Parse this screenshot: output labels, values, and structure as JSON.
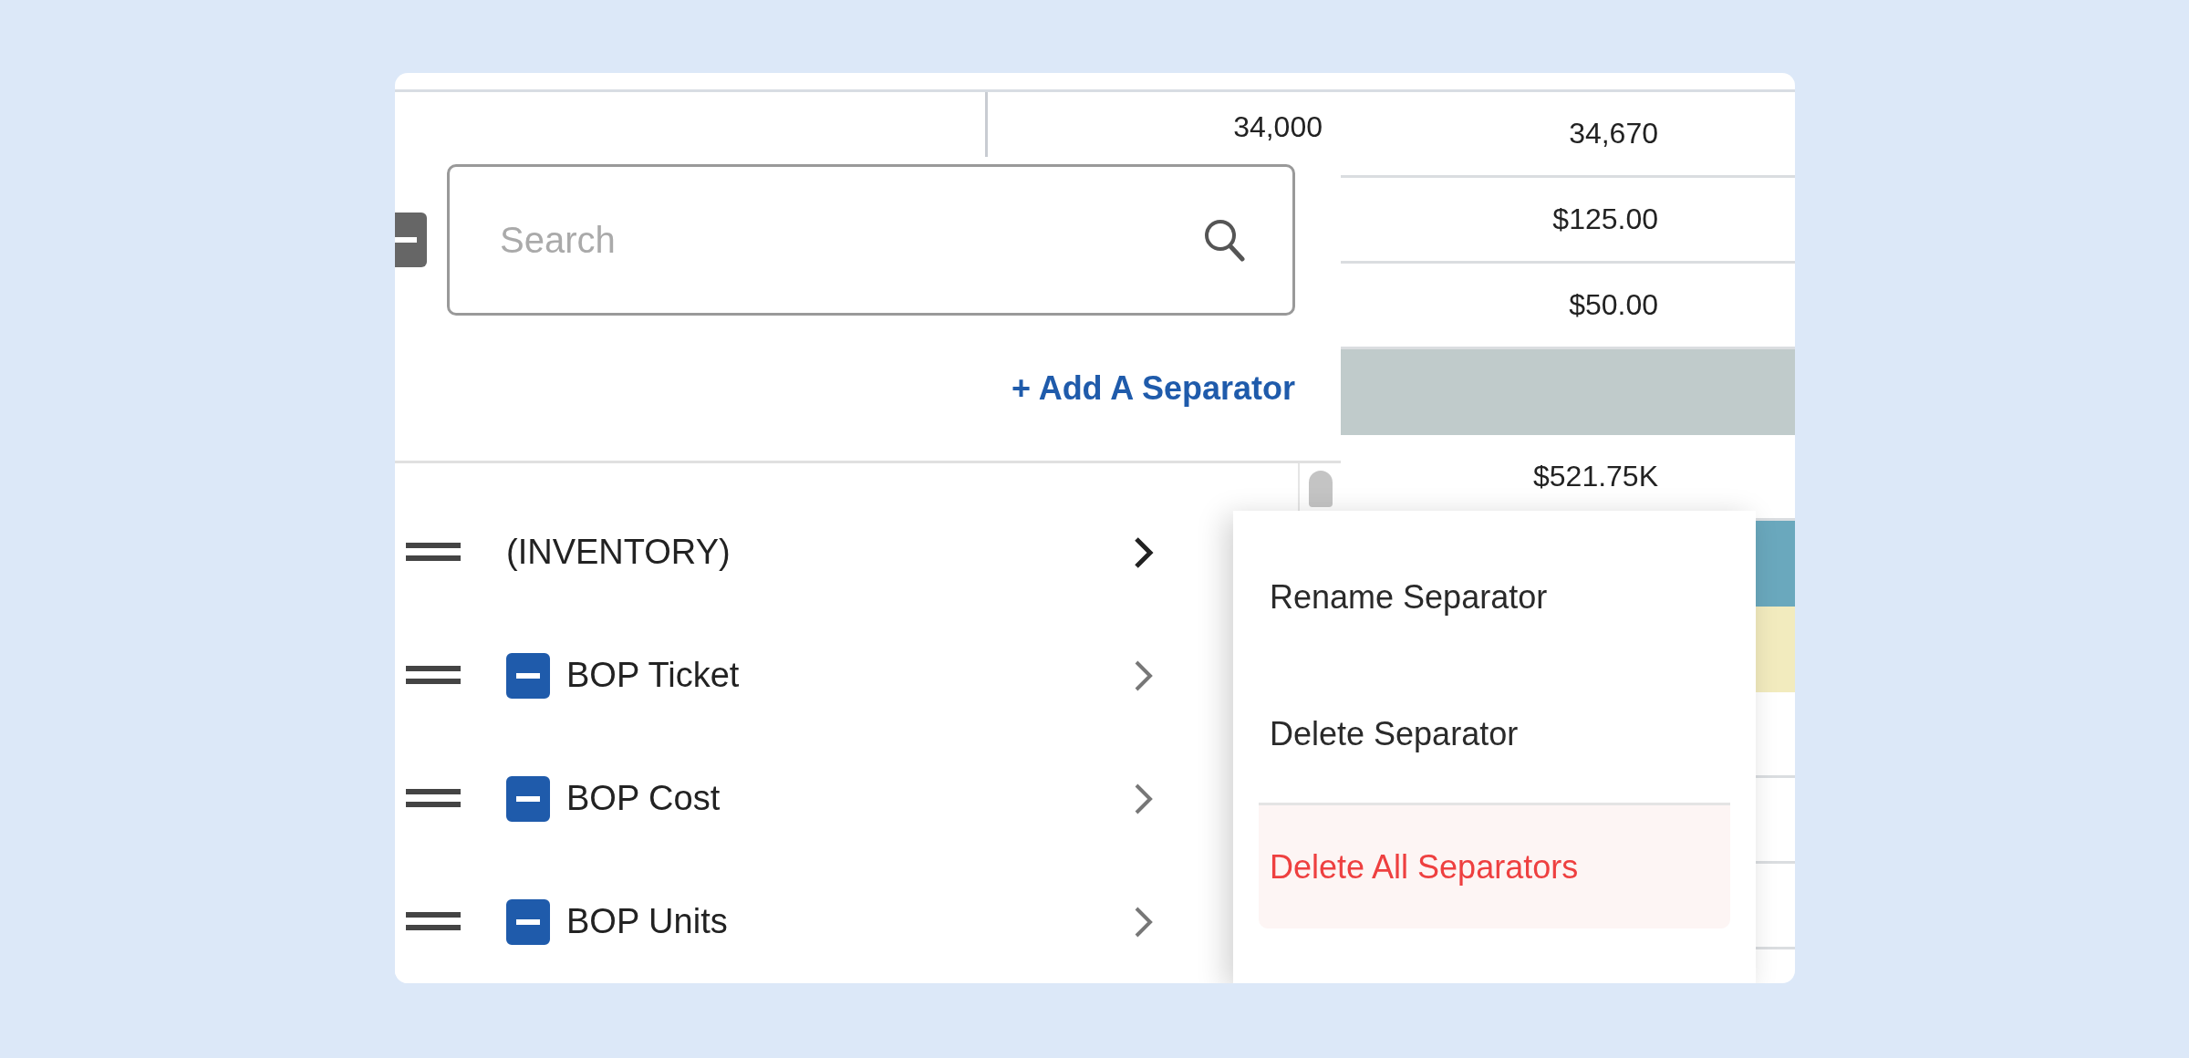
{
  "table": {
    "rows": [
      {
        "kind": "value",
        "column_1": "34,000",
        "column_2": "34,670"
      },
      {
        "kind": "value",
        "column_2": "$125.00"
      },
      {
        "kind": "value",
        "column_2": "$50.00"
      },
      {
        "kind": "band",
        "color": "#c0cbcb"
      },
      {
        "kind": "value",
        "column_2": "$521.75K"
      },
      {
        "kind": "band",
        "color": "#6aa8bd"
      },
      {
        "kind": "band",
        "color": "#f2ebbe"
      },
      {
        "kind": "value"
      },
      {
        "kind": "value"
      },
      {
        "kind": "value"
      },
      {
        "kind": "value"
      }
    ]
  },
  "panel": {
    "search": {
      "placeholder": "Search"
    },
    "add_link": "+ Add A Separator",
    "items": [
      {
        "kind": "separator",
        "label": "(INVENTORY)"
      },
      {
        "kind": "field",
        "label": "BOP Ticket",
        "checked": true
      },
      {
        "kind": "field",
        "label": "BOP Cost",
        "checked": true
      },
      {
        "kind": "field",
        "label": "BOP Units",
        "checked": true
      }
    ]
  },
  "menu": {
    "items": [
      {
        "kind": "normal",
        "label": "Rename Separator"
      },
      {
        "kind": "normal",
        "label": "Delete Separator"
      },
      {
        "kind": "danger",
        "label": "Delete All Separators"
      }
    ]
  }
}
